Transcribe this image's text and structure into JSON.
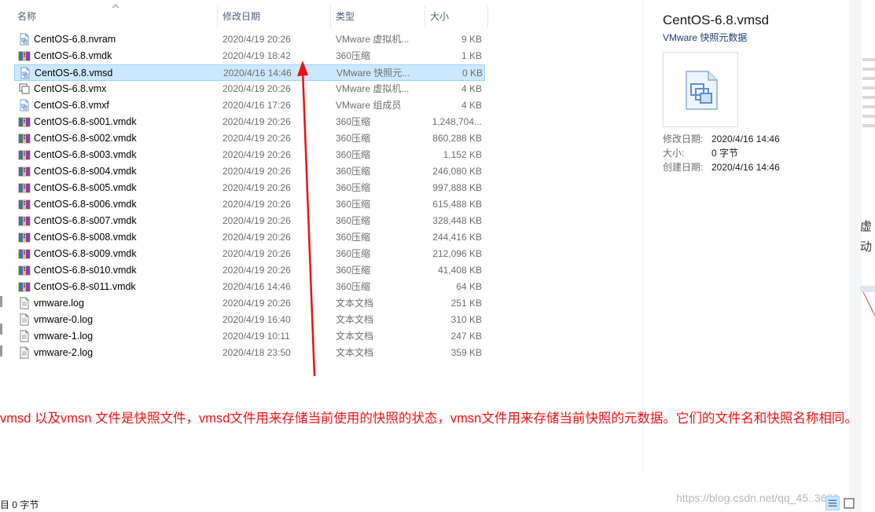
{
  "columns": {
    "name": "名称",
    "date": "修改日期",
    "type": "类型",
    "size": "大小"
  },
  "files": [
    {
      "name": "CentOS-6.8.nvram",
      "date": "2020/4/19 20:26",
      "type": "VMware 虚拟机...",
      "size": "9 KB",
      "icon": "vmware-file-icon"
    },
    {
      "name": "CentOS-6.8.vmdk",
      "date": "2020/4/19 18:42",
      "type": "360压缩",
      "size": "1 KB",
      "icon": "archive-icon"
    },
    {
      "name": "CentOS-6.8.vmsd",
      "date": "2020/4/16 14:46",
      "type": "VMware 快照元...",
      "size": "0 KB",
      "icon": "vmware-file-icon",
      "selected": true
    },
    {
      "name": "CentOS-6.8.vmx",
      "date": "2020/4/19 20:26",
      "type": "VMware 虚拟机...",
      "size": "4 KB",
      "icon": "vm-config-icon"
    },
    {
      "name": "CentOS-6.8.vmxf",
      "date": "2020/4/16 17:26",
      "type": "VMware 组成员",
      "size": "4 KB",
      "icon": "vmware-file-icon"
    },
    {
      "name": "CentOS-6.8-s001.vmdk",
      "date": "2020/4/19 20:26",
      "type": "360压缩",
      "size": "1,248,704...",
      "icon": "archive-icon"
    },
    {
      "name": "CentOS-6.8-s002.vmdk",
      "date": "2020/4/19 20:26",
      "type": "360压缩",
      "size": "860,288 KB",
      "icon": "archive-icon"
    },
    {
      "name": "CentOS-6.8-s003.vmdk",
      "date": "2020/4/19 20:26",
      "type": "360压缩",
      "size": "1,152 KB",
      "icon": "archive-icon"
    },
    {
      "name": "CentOS-6.8-s004.vmdk",
      "date": "2020/4/19 20:26",
      "type": "360压缩",
      "size": "246,080 KB",
      "icon": "archive-icon"
    },
    {
      "name": "CentOS-6.8-s005.vmdk",
      "date": "2020/4/19 20:26",
      "type": "360压缩",
      "size": "997,888 KB",
      "icon": "archive-icon"
    },
    {
      "name": "CentOS-6.8-s006.vmdk",
      "date": "2020/4/19 20:26",
      "type": "360压缩",
      "size": "615,488 KB",
      "icon": "archive-icon"
    },
    {
      "name": "CentOS-6.8-s007.vmdk",
      "date": "2020/4/19 20:26",
      "type": "360压缩",
      "size": "328,448 KB",
      "icon": "archive-icon"
    },
    {
      "name": "CentOS-6.8-s008.vmdk",
      "date": "2020/4/19 20:26",
      "type": "360压缩",
      "size": "244,416 KB",
      "icon": "archive-icon"
    },
    {
      "name": "CentOS-6.8-s009.vmdk",
      "date": "2020/4/19 20:26",
      "type": "360压缩",
      "size": "212,096 KB",
      "icon": "archive-icon"
    },
    {
      "name": "CentOS-6.8-s010.vmdk",
      "date": "2020/4/19 20:26",
      "type": "360压缩",
      "size": "41,408 KB",
      "icon": "archive-icon"
    },
    {
      "name": "CentOS-6.8-s011.vmdk",
      "date": "2020/4/16 14:46",
      "type": "360压缩",
      "size": "64 KB",
      "icon": "archive-icon"
    },
    {
      "name": "vmware.log",
      "date": "2020/4/19 20:26",
      "type": "文本文档",
      "size": "251 KB",
      "icon": "text-file-icon"
    },
    {
      "name": "vmware-0.log",
      "date": "2020/4/19 16:40",
      "type": "文本文档",
      "size": "310 KB",
      "icon": "text-file-icon"
    },
    {
      "name": "vmware-1.log",
      "date": "2020/4/19 10:11",
      "type": "文本文档",
      "size": "247 KB",
      "icon": "text-file-icon"
    },
    {
      "name": "vmware-2.log",
      "date": "2020/4/18 23:50",
      "type": "文本文档",
      "size": "359 KB",
      "icon": "text-file-icon"
    }
  ],
  "details": {
    "title": "CentOS-6.8.vmsd",
    "subtitle": "VMware 快照元数据",
    "props": [
      {
        "key": "修改日期:",
        "value": "2020/4/16 14:46"
      },
      {
        "key": "大小:",
        "value": "0 字节"
      },
      {
        "key": "创建日期:",
        "value": "2020/4/16 14:46"
      }
    ]
  },
  "annotation": {
    "text": "vmsd 以及vmsn 文件是快照文件，vmsd文件用来存储当前使用的快照的状态，vmsn文件用来存储当前快照的元数据。它们的文件名和快照名称相同。",
    "color": "#ee1111"
  },
  "status": {
    "text": "目 0 字节"
  },
  "watermark": "https://blog.csdn.net/qq_45..3620",
  "background_window": {
    "fragment_1": "虚",
    "fragment_2": "动"
  },
  "colors": {
    "selection_bg": "#cce8ff",
    "selection_border": "#99d1ff",
    "header_text": "#4c607a",
    "annotation": "#ee1111"
  }
}
